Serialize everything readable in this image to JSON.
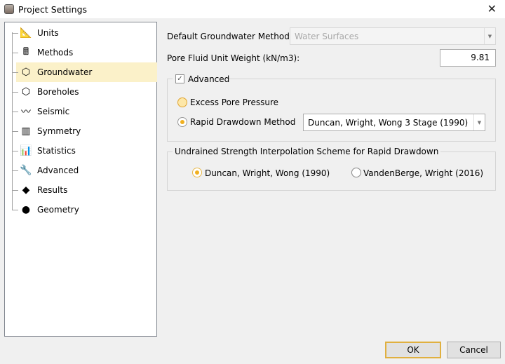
{
  "window": {
    "title": "Project Settings",
    "close": "✕"
  },
  "tree": {
    "items": [
      {
        "label": "Units",
        "icon": "ruler-triangle-icon",
        "glyph": "📐"
      },
      {
        "label": "Methods",
        "icon": "calculator-icon",
        "glyph": "🖩"
      },
      {
        "label": "Groundwater",
        "icon": "groundwater-cube-icon",
        "glyph": "⬡"
      },
      {
        "label": "Boreholes",
        "icon": "boreholes-icon",
        "glyph": "⬡"
      },
      {
        "label": "Seismic",
        "icon": "seismic-icon",
        "glyph": "〰"
      },
      {
        "label": "Symmetry",
        "icon": "symmetry-icon",
        "glyph": "▥"
      },
      {
        "label": "Statistics",
        "icon": "statistics-icon",
        "glyph": "📊"
      },
      {
        "label": "Advanced",
        "icon": "advanced-tool-icon",
        "glyph": "🔧"
      },
      {
        "label": "Results",
        "icon": "results-cube-icon",
        "glyph": "◆"
      },
      {
        "label": "Geometry",
        "icon": "geometry-icon",
        "glyph": "●"
      }
    ],
    "selected": "Groundwater"
  },
  "form": {
    "method_label": "Default Groundwater Method:",
    "method_value": "Water Surfaces",
    "weight_label": "Pore Fluid Unit Weight (kN/m3):",
    "weight_value": "9.81",
    "advanced_label": "Advanced",
    "advanced_checked": true,
    "excess_label": "Excess Pore Pressure",
    "rapid_label": "Rapid Drawdown Method",
    "rapid_value": "Duncan, Wright, Wong 3 Stage (1990)",
    "undrained_title": "Undrained Strength Interpolation Scheme for Rapid Drawdown",
    "opt1": "Duncan, Wright, Wong (1990)",
    "opt2": "VandenBerge, Wright (2016)"
  },
  "buttons": {
    "ok": "OK",
    "cancel": "Cancel"
  },
  "colors": {
    "selection": "#fbf1c9",
    "radio_accent": "#f0b020"
  }
}
